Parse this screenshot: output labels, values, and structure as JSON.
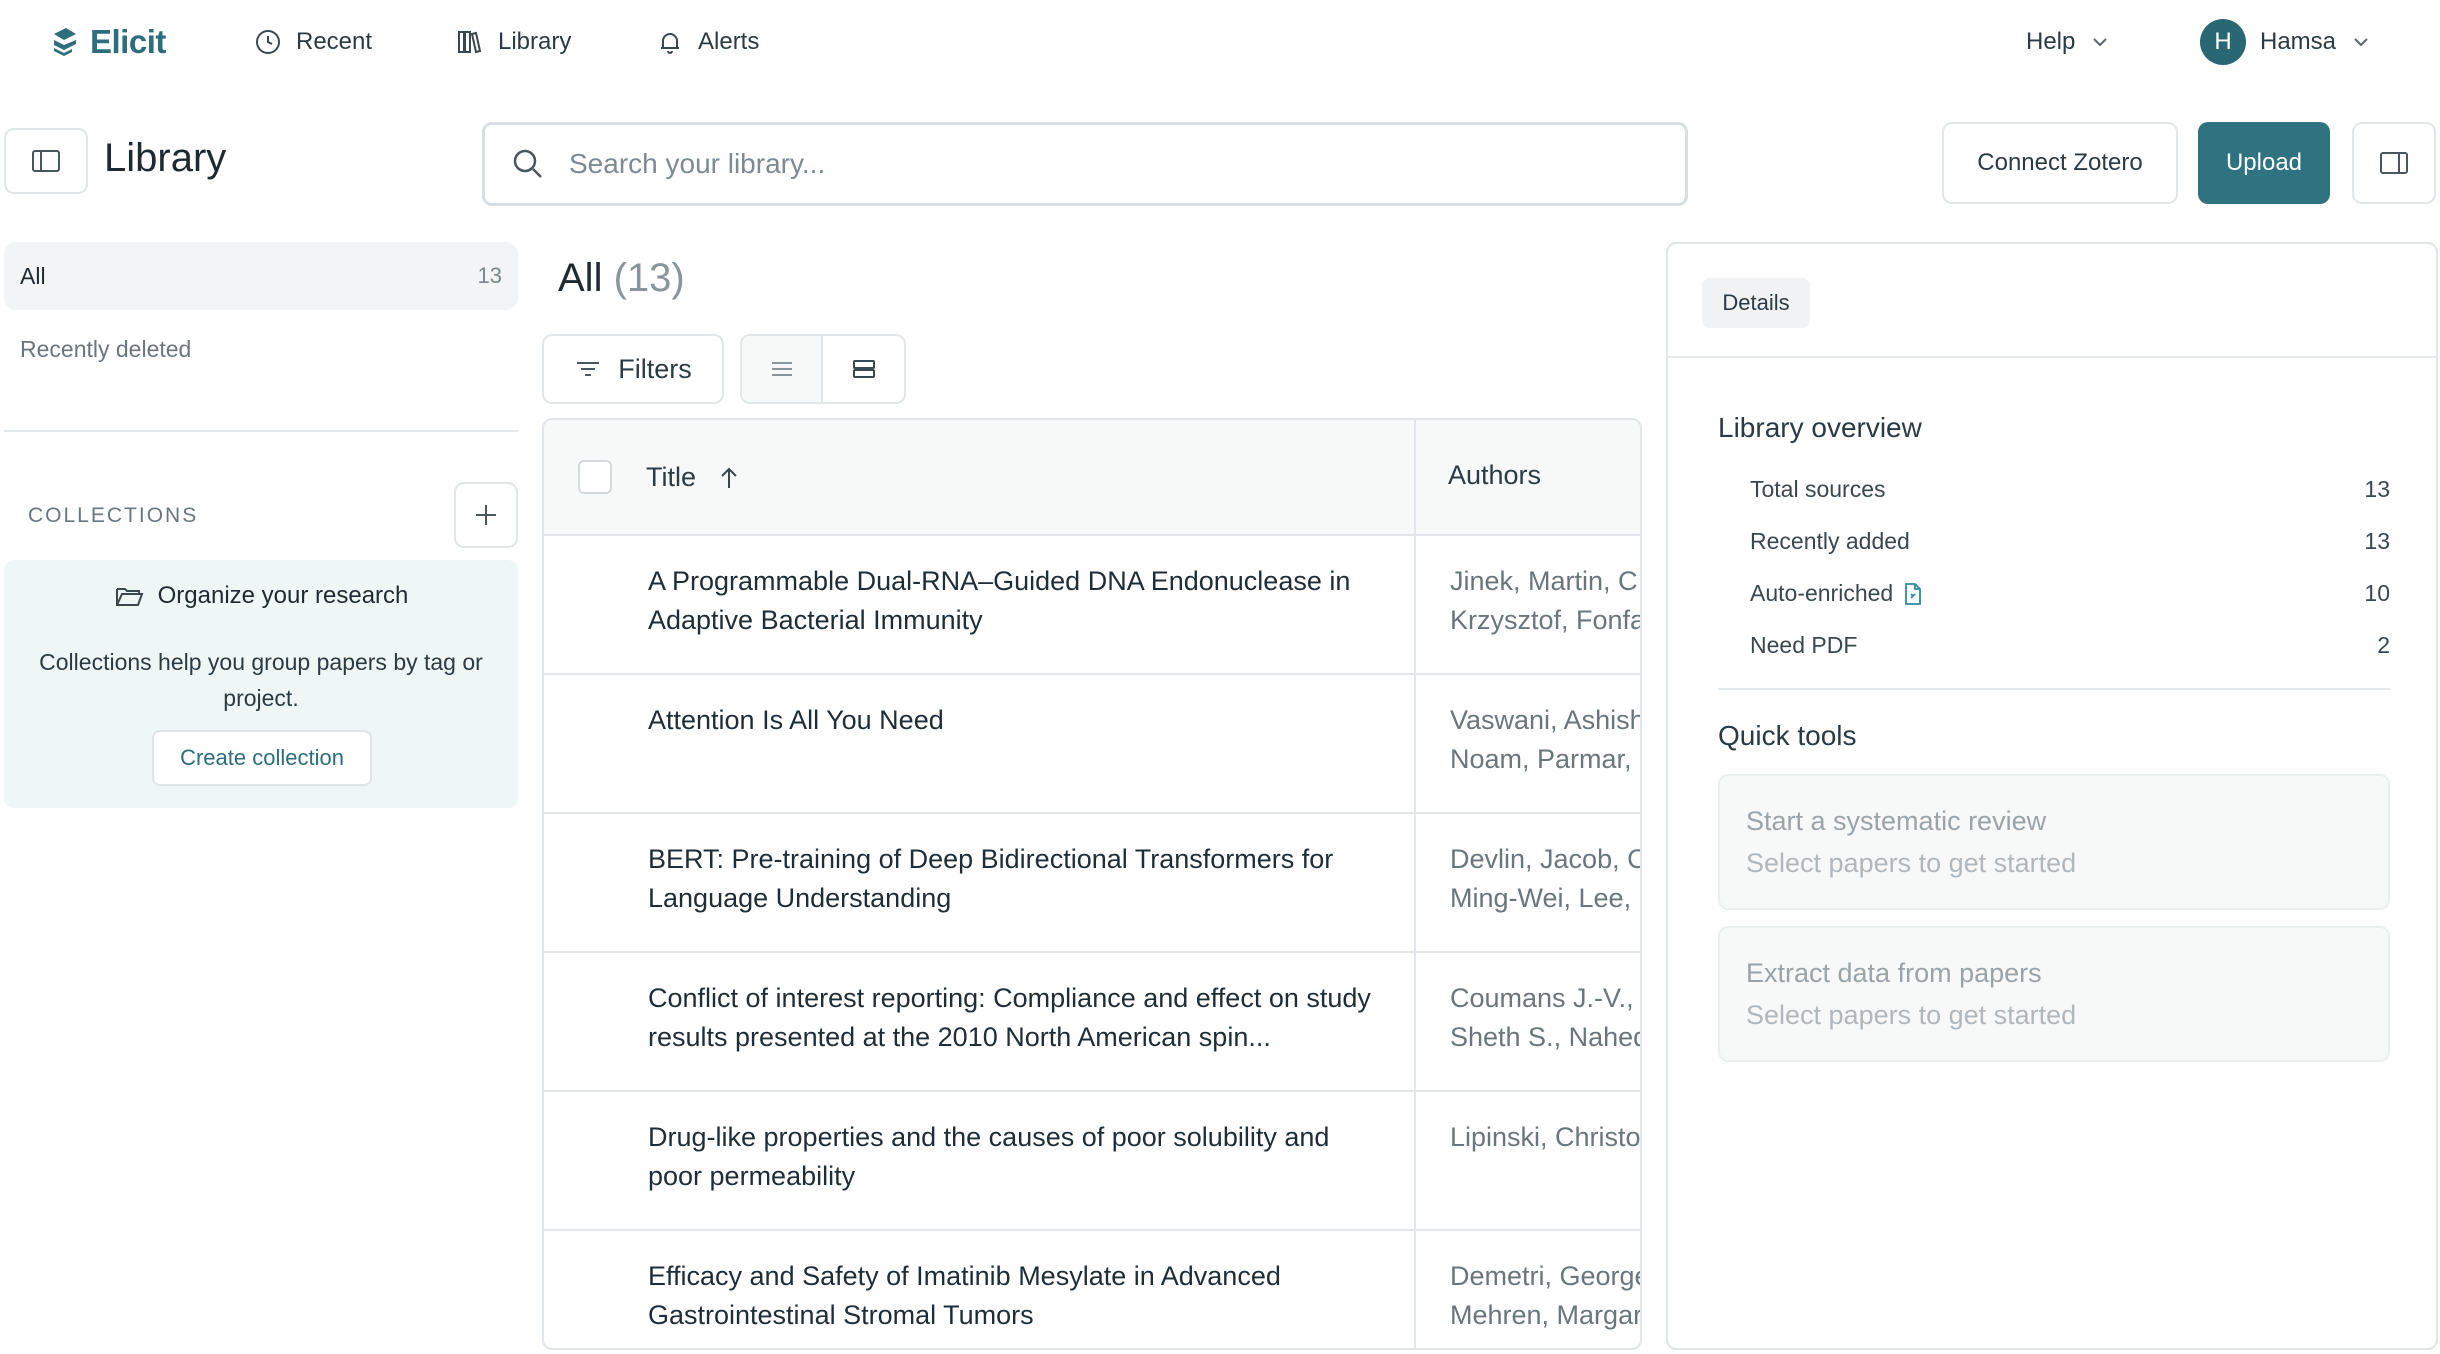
{
  "nav": {
    "brand": "Elicit",
    "items": [
      {
        "label": "Recent",
        "icon": "clock-icon"
      },
      {
        "label": "Library",
        "icon": "books-icon"
      },
      {
        "label": "Alerts",
        "icon": "bell-icon"
      }
    ],
    "help_label": "Help",
    "user": {
      "initial": "H",
      "name": "Hamsa"
    }
  },
  "header": {
    "title": "Library",
    "search_placeholder": "Search your library...",
    "connect_zotero": "Connect Zotero",
    "upload": "Upload"
  },
  "sidebar": {
    "all_label": "All",
    "all_count": "13",
    "recently_deleted": "Recently deleted",
    "collections_label": "COLLECTIONS",
    "empty_title": "Organize your research",
    "empty_desc": "Collections help you group papers by tag or project.",
    "create_collection": "Create collection"
  },
  "list": {
    "heading": "All",
    "count": "(13)",
    "filters_label": "Filters",
    "columns": {
      "title": "Title",
      "authors": "Authors"
    },
    "rows": [
      {
        "title": "A Programmable Dual-RNA–Guided DNA Endonuclease in Adaptive Bacterial Immunity",
        "authors_line1": "Jinek, Martin, C",
        "authors_line2": "Krzysztof, Fonfa"
      },
      {
        "title": "Attention Is All You Need",
        "authors_line1": "Vaswani, Ashish",
        "authors_line2": "Noam, Parmar, I"
      },
      {
        "title": "BERT: Pre-training of Deep Bidirectional Transformers for Language Understanding",
        "authors_line1": "Devlin, Jacob, C",
        "authors_line2": "Ming-Wei, Lee,"
      },
      {
        "title": "Conflict of interest reporting: Compliance and effect on study results presented at the 2010 North American spin...",
        "authors_line1": "Coumans J.-V.,",
        "authors_line2": "Sheth S., Nahed"
      },
      {
        "title": "Drug-like properties and the causes of poor solubility and poor permeability",
        "authors_line1": "Lipinski, Christo",
        "authors_line2": ""
      },
      {
        "title": "Efficacy and Safety of Imatinib Mesylate in Advanced Gastrointestinal Stromal Tumors",
        "authors_line1": "Demetri, George",
        "authors_line2": "Mehren, Margar"
      }
    ]
  },
  "details": {
    "tab_label": "Details",
    "overview_title": "Library overview",
    "stats": [
      {
        "label": "Total sources",
        "value": "13"
      },
      {
        "label": "Recently added",
        "value": "13"
      },
      {
        "label": "Auto-enriched",
        "value": "10"
      },
      {
        "label": "Need PDF",
        "value": "2"
      }
    ],
    "tools_title": "Quick tools",
    "tools": [
      {
        "title": "Start a systematic review",
        "subtitle": "Select papers to get started"
      },
      {
        "title": "Extract data from papers",
        "subtitle": "Select papers to get started"
      }
    ]
  },
  "colors": {
    "brand": "#2c6e7b",
    "primary_button": "#2f7280",
    "avatar": "#2a6774",
    "collections_card": "#eef7f6"
  }
}
